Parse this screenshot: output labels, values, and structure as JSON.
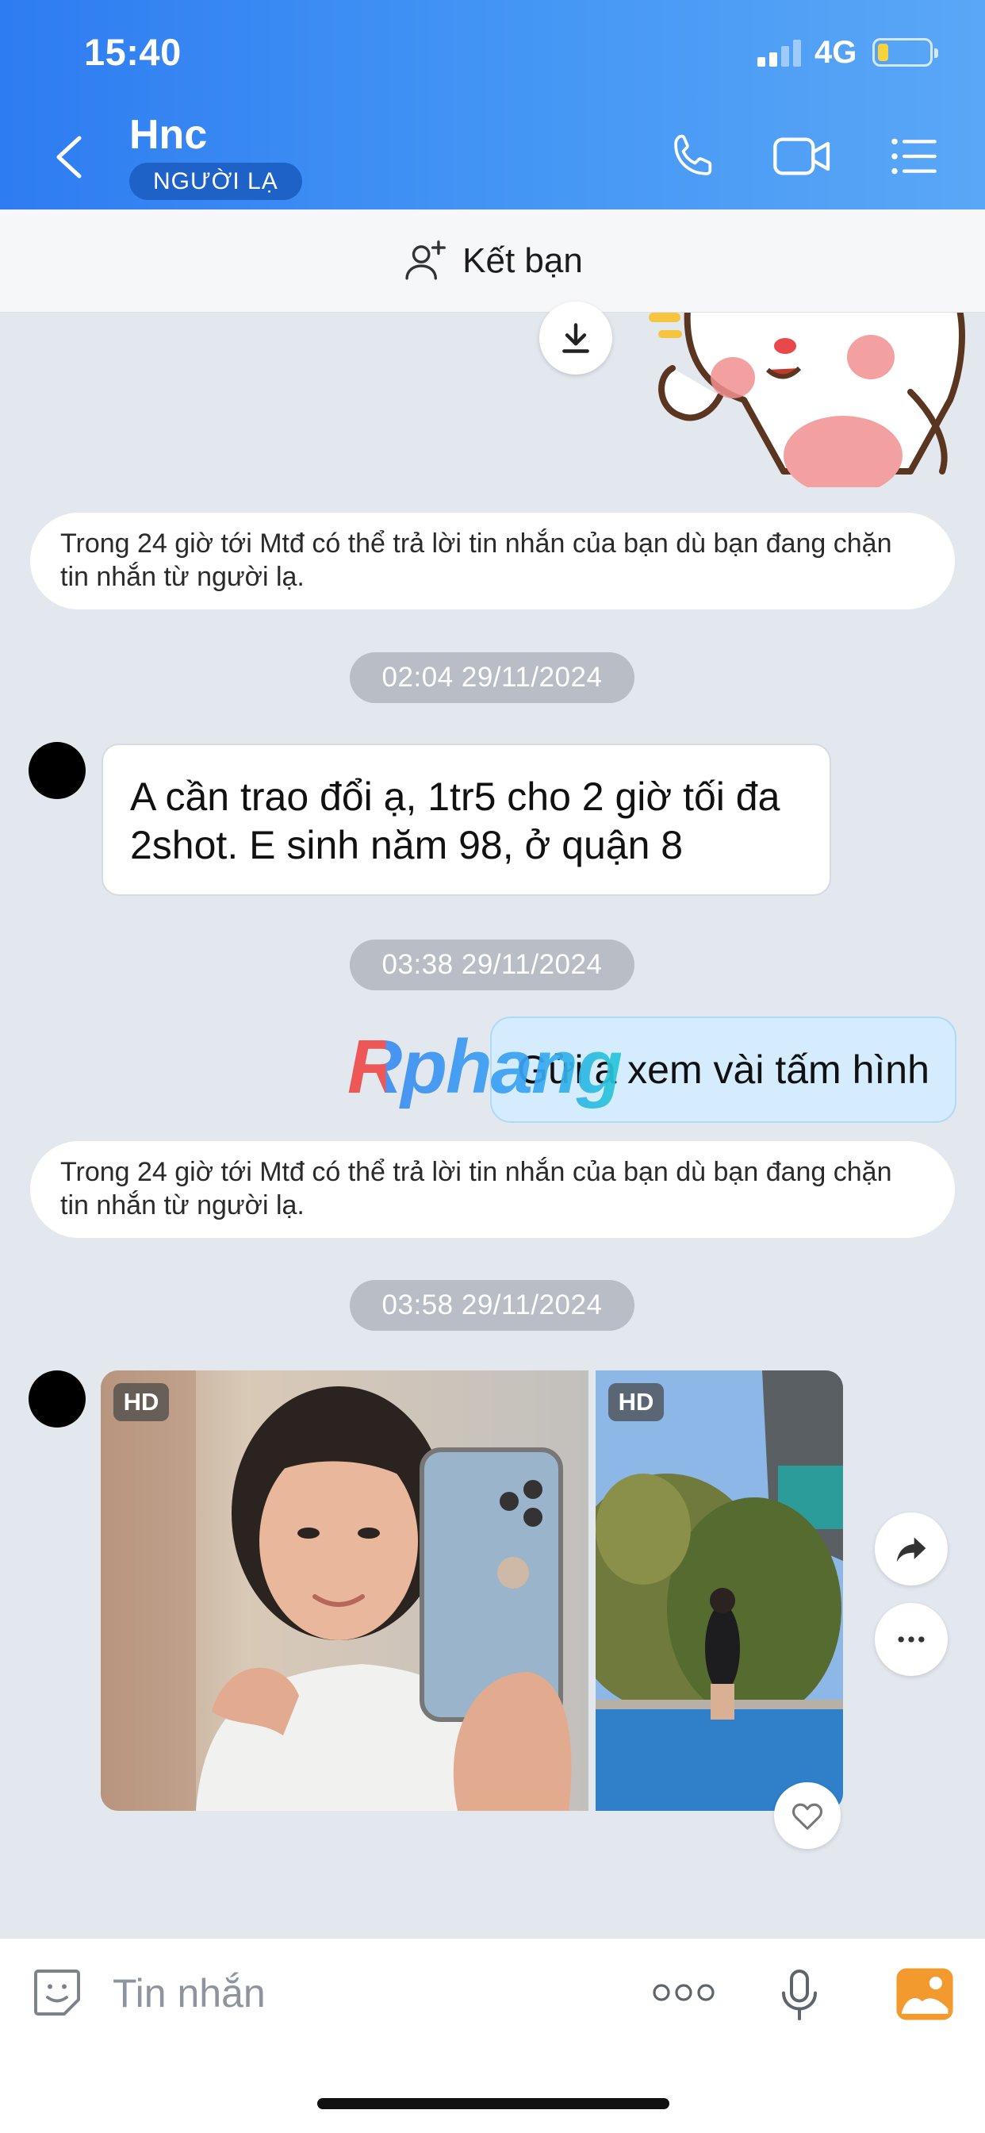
{
  "status_bar": {
    "time": "15:40",
    "network": "4G"
  },
  "header": {
    "contact_name": "Hnc",
    "badge": "NGƯỜI LẠ",
    "icons": [
      "back-icon",
      "phone-icon",
      "video-call-icon",
      "menu-list-icon"
    ]
  },
  "friend_bar": {
    "label": "Kết bạn",
    "icon": "add-friend-icon"
  },
  "messages": {
    "system_note_1": "Trong 24 giờ tới Mtđ có thể trả lời tin nhắn của bạn dù bạn đang chặn tin nhắn từ người lạ.",
    "timestamp_1": "02:04 29/11/2024",
    "incoming_text": "A cần trao đổi ạ, 1tr5 cho 2 giờ tối đa 2shot. E sinh năm 98, ở quận 8",
    "timestamp_2": "03:38 29/11/2024",
    "outgoing_text": "Gửi a xem vài tấm hình",
    "watermark": "Rphang",
    "system_note_2": "Trong 24 giờ tới Mtđ có thể trả lời tin nhắn của bạn dù bạn đang chặn tin nhắn từ người lạ.",
    "timestamp_3": "03:58 29/11/2024",
    "photo_badge_1": "HD",
    "photo_badge_2": "HD"
  },
  "input_bar": {
    "placeholder": "Tin nhắn"
  },
  "colors": {
    "header_blue": "#3b8cf3",
    "chat_background": "#e3e7ee",
    "outgoing_bubble": "#d4ecfd",
    "timestamp_pill": "#b9bec6"
  }
}
